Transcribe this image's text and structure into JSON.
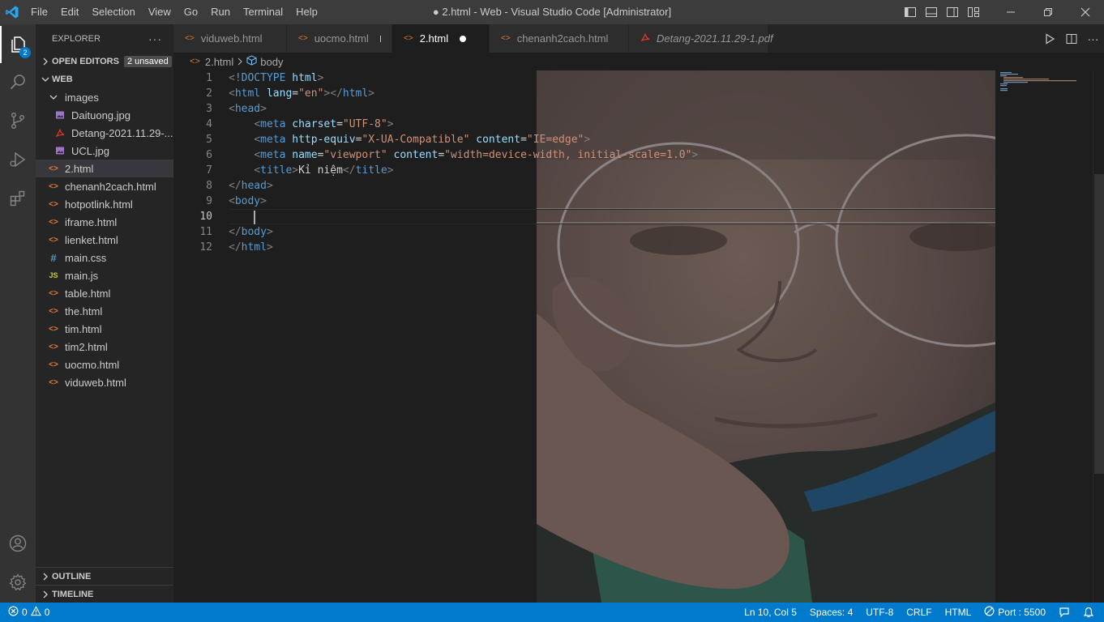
{
  "window": {
    "title": "● 2.html - Web - Visual Studio Code [Administrator]",
    "menu": [
      "File",
      "Edit",
      "Selection",
      "View",
      "Go",
      "Run",
      "Terminal",
      "Help"
    ]
  },
  "activity_bar": {
    "explorer_badge": "2"
  },
  "explorer": {
    "header": "EXPLORER",
    "more": "···",
    "open_editors": {
      "label": "OPEN EDITORS",
      "badge": "2 unsaved"
    },
    "workspace": "WEB",
    "items": [
      {
        "label": "images",
        "icon": "chevron-down",
        "indent": 1,
        "color": "#cccccc"
      },
      {
        "label": "Daituong.jpg",
        "icon": "image",
        "indent": 2,
        "color": "#a074c4"
      },
      {
        "label": "Detang-2021.11.29-...",
        "icon": "pdf",
        "indent": 2,
        "color": "#e5362b"
      },
      {
        "label": "UCL.jpg",
        "icon": "image",
        "indent": 2,
        "color": "#a074c4"
      },
      {
        "label": "2.html",
        "icon": "html",
        "indent": 1,
        "color": "#e37933",
        "selected": true
      },
      {
        "label": "chenanh2cach.html",
        "icon": "html",
        "indent": 1,
        "color": "#e37933"
      },
      {
        "label": "hotpotlink.html",
        "icon": "html",
        "indent": 1,
        "color": "#e37933"
      },
      {
        "label": "iframe.html",
        "icon": "html",
        "indent": 1,
        "color": "#e37933"
      },
      {
        "label": "lienket.html",
        "icon": "html",
        "indent": 1,
        "color": "#e37933"
      },
      {
        "label": "main.css",
        "icon": "css",
        "indent": 1,
        "color": "#519aba"
      },
      {
        "label": "main.js",
        "icon": "js",
        "indent": 1,
        "color": "#cbcb41"
      },
      {
        "label": "table.html",
        "icon": "html",
        "indent": 1,
        "color": "#e37933"
      },
      {
        "label": "the.html",
        "icon": "html",
        "indent": 1,
        "color": "#e37933"
      },
      {
        "label": "tim.html",
        "icon": "html",
        "indent": 1,
        "color": "#e37933"
      },
      {
        "label": "tim2.html",
        "icon": "html",
        "indent": 1,
        "color": "#e37933"
      },
      {
        "label": "uocmo.html",
        "icon": "html",
        "indent": 1,
        "color": "#e37933"
      },
      {
        "label": "viduweb.html",
        "icon": "html",
        "indent": 1,
        "color": "#e37933"
      }
    ],
    "outline": "OUTLINE",
    "timeline": "TIMELINE"
  },
  "tabs": [
    {
      "label": "viduweb.html",
      "icon": "html",
      "active": false,
      "dirty": false
    },
    {
      "label": "uocmo.html",
      "icon": "html",
      "active": false,
      "dirty": true
    },
    {
      "label": "2.html",
      "icon": "html",
      "active": true,
      "dirty": true
    },
    {
      "label": "chenanh2cach.html",
      "icon": "html",
      "active": false,
      "dirty": false
    },
    {
      "label": "Detang-2021.11.29-1.pdf",
      "icon": "pdf",
      "active": false,
      "dirty": false,
      "italic": true
    }
  ],
  "breadcrumb": {
    "file": "2.html",
    "symbol": "body"
  },
  "editor": {
    "current_line": 10,
    "lines": [
      [
        [
          "punc",
          "<"
        ],
        [
          "tag",
          "!DOCTYPE"
        ],
        [
          "txt",
          " "
        ],
        [
          "attr",
          "html"
        ],
        [
          "punc",
          ">"
        ]
      ],
      [
        [
          "punc",
          "<"
        ],
        [
          "tag",
          "html"
        ],
        [
          "txt",
          " "
        ],
        [
          "attr",
          "lang"
        ],
        [
          "txt",
          "="
        ],
        [
          "str",
          "\"en\""
        ],
        [
          "punc",
          "></"
        ],
        [
          "tag",
          "html"
        ],
        [
          "punc",
          ">"
        ]
      ],
      [
        [
          "punc",
          "<"
        ],
        [
          "tag",
          "head"
        ],
        [
          "punc",
          ">"
        ]
      ],
      [
        [
          "txt",
          "    "
        ],
        [
          "punc",
          "<"
        ],
        [
          "tag",
          "meta"
        ],
        [
          "txt",
          " "
        ],
        [
          "attr",
          "charset"
        ],
        [
          "txt",
          "="
        ],
        [
          "str",
          "\"UTF-8\""
        ],
        [
          "punc",
          ">"
        ]
      ],
      [
        [
          "txt",
          "    "
        ],
        [
          "punc",
          "<"
        ],
        [
          "tag",
          "meta"
        ],
        [
          "txt",
          " "
        ],
        [
          "attr",
          "http-equiv"
        ],
        [
          "txt",
          "="
        ],
        [
          "str",
          "\"X-UA-Compatible\""
        ],
        [
          "txt",
          " "
        ],
        [
          "attr",
          "content"
        ],
        [
          "txt",
          "="
        ],
        [
          "str",
          "\"IE=edge\""
        ],
        [
          "punc",
          ">"
        ]
      ],
      [
        [
          "txt",
          "    "
        ],
        [
          "punc",
          "<"
        ],
        [
          "tag",
          "meta"
        ],
        [
          "txt",
          " "
        ],
        [
          "attr",
          "name"
        ],
        [
          "txt",
          "="
        ],
        [
          "str",
          "\"viewport\""
        ],
        [
          "txt",
          " "
        ],
        [
          "attr",
          "content"
        ],
        [
          "txt",
          "="
        ],
        [
          "str",
          "\"width=device-width, initial-scale=1.0\""
        ],
        [
          "punc",
          ">"
        ]
      ],
      [
        [
          "txt",
          "    "
        ],
        [
          "punc",
          "<"
        ],
        [
          "tag",
          "title"
        ],
        [
          "punc",
          ">"
        ],
        [
          "txt",
          "Kỉ niệm"
        ],
        [
          "punc",
          "</"
        ],
        [
          "tag",
          "title"
        ],
        [
          "punc",
          ">"
        ]
      ],
      [
        [
          "punc",
          "</"
        ],
        [
          "tag",
          "head"
        ],
        [
          "punc",
          ">"
        ]
      ],
      [
        [
          "punc",
          "<"
        ],
        [
          "tag",
          "body"
        ],
        [
          "punc",
          ">"
        ]
      ],
      [
        [
          "txt",
          "    "
        ]
      ],
      [
        [
          "punc",
          "</"
        ],
        [
          "tag",
          "body"
        ],
        [
          "punc",
          ">"
        ]
      ],
      [
        [
          "punc",
          "</"
        ],
        [
          "tag",
          "html"
        ],
        [
          "punc",
          ">"
        ]
      ]
    ]
  },
  "status": {
    "errors": "0",
    "warnings": "0",
    "position": "Ln 10, Col 5",
    "spaces": "Spaces: 4",
    "encoding": "UTF-8",
    "eol": "CRLF",
    "language": "HTML",
    "port": "Port : 5500"
  },
  "colors": {
    "accent": "#007acc",
    "titlebar": "#3c3c3c",
    "activitybar": "#333333",
    "sidebar": "#252526",
    "editor": "#1e1e1e"
  }
}
